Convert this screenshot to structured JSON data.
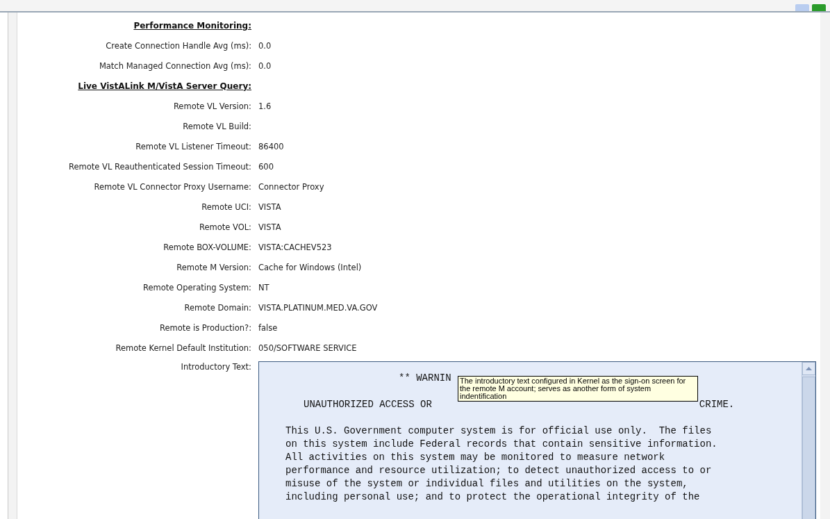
{
  "sections": [
    {
      "heading": "Performance Monitoring:",
      "rows": [
        {
          "label": "Create Connection Handle Avg (ms):",
          "value": "0.0"
        },
        {
          "label": "Match Managed Connection Avg (ms):",
          "value": "0.0"
        }
      ]
    },
    {
      "heading": "Live VistALink M/VistA Server Query:",
      "rows": [
        {
          "label": "Remote VL Version:",
          "value": "1.6"
        },
        {
          "label": "Remote VL Build:"
        },
        {
          "label": "Remote VL Listener Timeout:",
          "value": "86400"
        },
        {
          "label": "Remote VL Reauthenticated Session Timeout:",
          "value": "600"
        },
        {
          "label": "Remote VL Connector Proxy Username:",
          "value": "Connector Proxy"
        },
        {
          "label": "Remote UCI:",
          "value": "VISTA"
        },
        {
          "label": "Remote VOL:",
          "value": "VISTA"
        },
        {
          "label": "Remote BOX-VOLUME:",
          "value": "VISTA:CACHEV523"
        },
        {
          "label": "Remote M Version:",
          "value": "Cache for Windows (Intel)"
        },
        {
          "label": "Remote Operating System:",
          "value": "NT"
        },
        {
          "label": "Remote Domain:",
          "value": "VISTA.PLATINUM.MED.VA.GOV"
        },
        {
          "label": "Remote is Production?:",
          "value": "false"
        },
        {
          "label": "Remote Kernel Default Institution:",
          "value": "050/SOFTWARE SERVICE"
        }
      ]
    }
  ],
  "introductory_text": {
    "label": "Introductory Text:",
    "warning_line": "** WARNIN",
    "notice_line": [
      "UNAUTHORIZED ACCESS OR",
      "CRIME."
    ],
    "body": [
      "This U.S. Government computer system is for official use only.  The files",
      "on this system include Federal records that contain sensitive information.",
      "All activities on this system may be monitored to measure network",
      "performance and resource utilization; to detect unauthorized access to or",
      "misuse of the system or individual files and utilities on the system,",
      "including personal use; and to protect the operational integrity of the"
    ],
    "tooltip": "The introductory text configured in Kernel as the sign-on screen for the remote M account; serves as another form of system indentification"
  }
}
